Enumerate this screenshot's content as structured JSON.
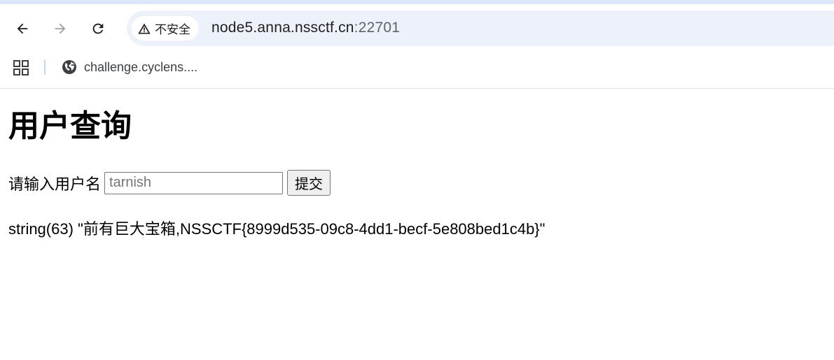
{
  "browser": {
    "security_label": "不安全",
    "url_host": "node5.anna.nssctf.cn",
    "url_port": ":22701",
    "bookmarks": [
      {
        "label": "challenge.cyclens...."
      }
    ]
  },
  "page": {
    "title": "用户查询",
    "form": {
      "label": "请输入用户名",
      "input_placeholder": "tarnish",
      "input_value": "",
      "submit_label": "提交"
    },
    "result": "string(63) \"前有巨大宝箱,NSSCTF{8999d535-09c8-4dd1-becf-5e808bed1c4b}\""
  }
}
